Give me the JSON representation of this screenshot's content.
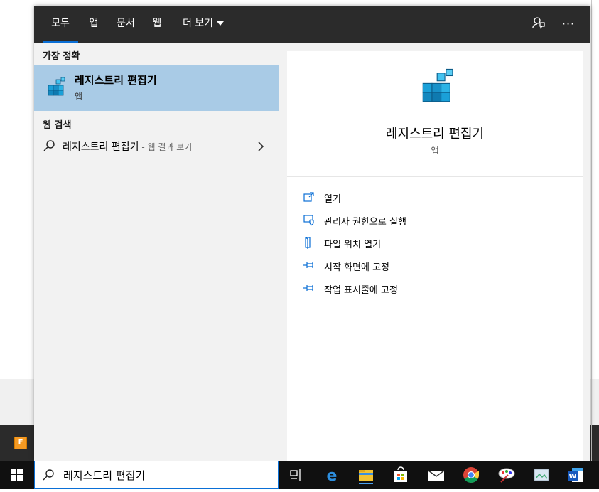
{
  "tabs": [
    {
      "label": "모두",
      "active": true
    },
    {
      "label": "앱"
    },
    {
      "label": "문서"
    },
    {
      "label": "웹"
    },
    {
      "label": "더 보기"
    }
  ],
  "best_match": {
    "section": "가장 정확",
    "name": "레지스트리 편집기",
    "type": "앱"
  },
  "web_search": {
    "section": "웹 검색",
    "query": "레지스트리 편집기",
    "suffix": " - 웹 결과 보기"
  },
  "preview": {
    "name": "레지스트리 편집기",
    "type": "앱",
    "actions": [
      {
        "label": "열기",
        "icon": "open-icon"
      },
      {
        "label": "관리자 권한으로 실행",
        "icon": "shield-icon"
      },
      {
        "label": "파일 위치 열기",
        "icon": "file-location-icon"
      },
      {
        "label": "시작 화면에 고정",
        "icon": "pin-icon"
      },
      {
        "label": "작업 표시줄에 고정",
        "icon": "pin-icon"
      }
    ]
  },
  "search_box": {
    "value": "레지스트리 편집기"
  },
  "colors": {
    "accent": "#0a6fd6",
    "selected": "#a9cbe6",
    "topbar": "#2b2b2b"
  }
}
